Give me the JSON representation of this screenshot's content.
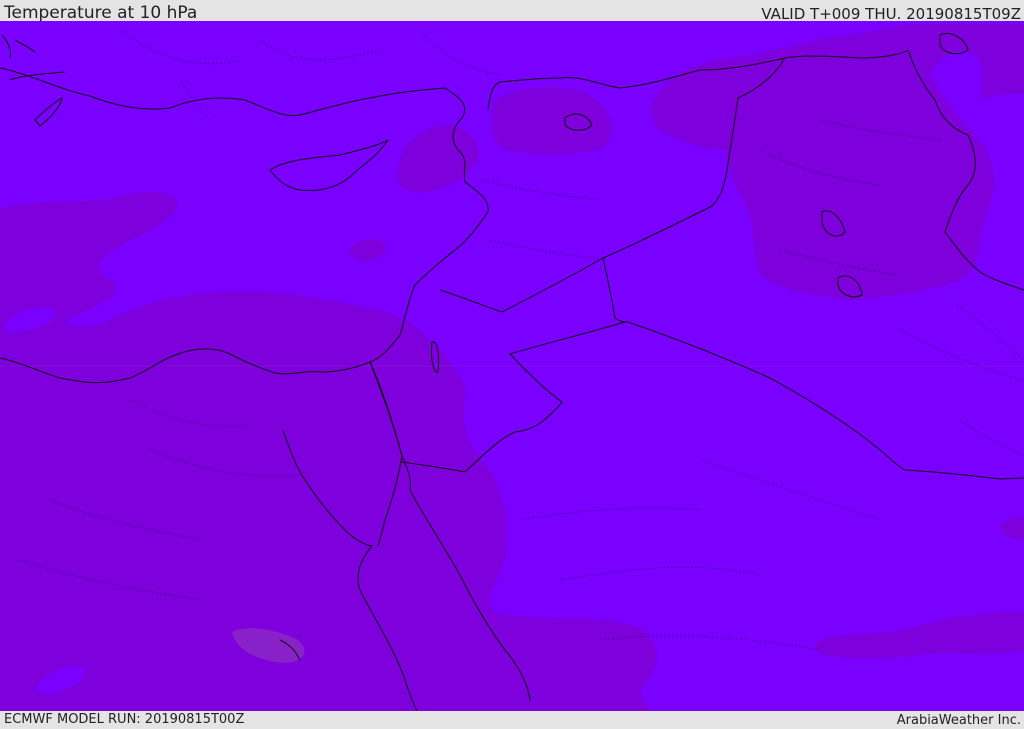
{
  "header": {
    "title": "Temperature at 10 hPa",
    "valid": "VALID T+009 THU. 20190815T09Z"
  },
  "footer": {
    "model_run": "ECMWF MODEL RUN: 20190815T00Z",
    "credit": "ArabiaWeather Inc."
  },
  "colors": {
    "field_warm": "#7a00ff",
    "field_cool": "#7e00dd",
    "field_coolest": "#8822c8",
    "border": "#111111",
    "frame": "#e4e4e4"
  }
}
